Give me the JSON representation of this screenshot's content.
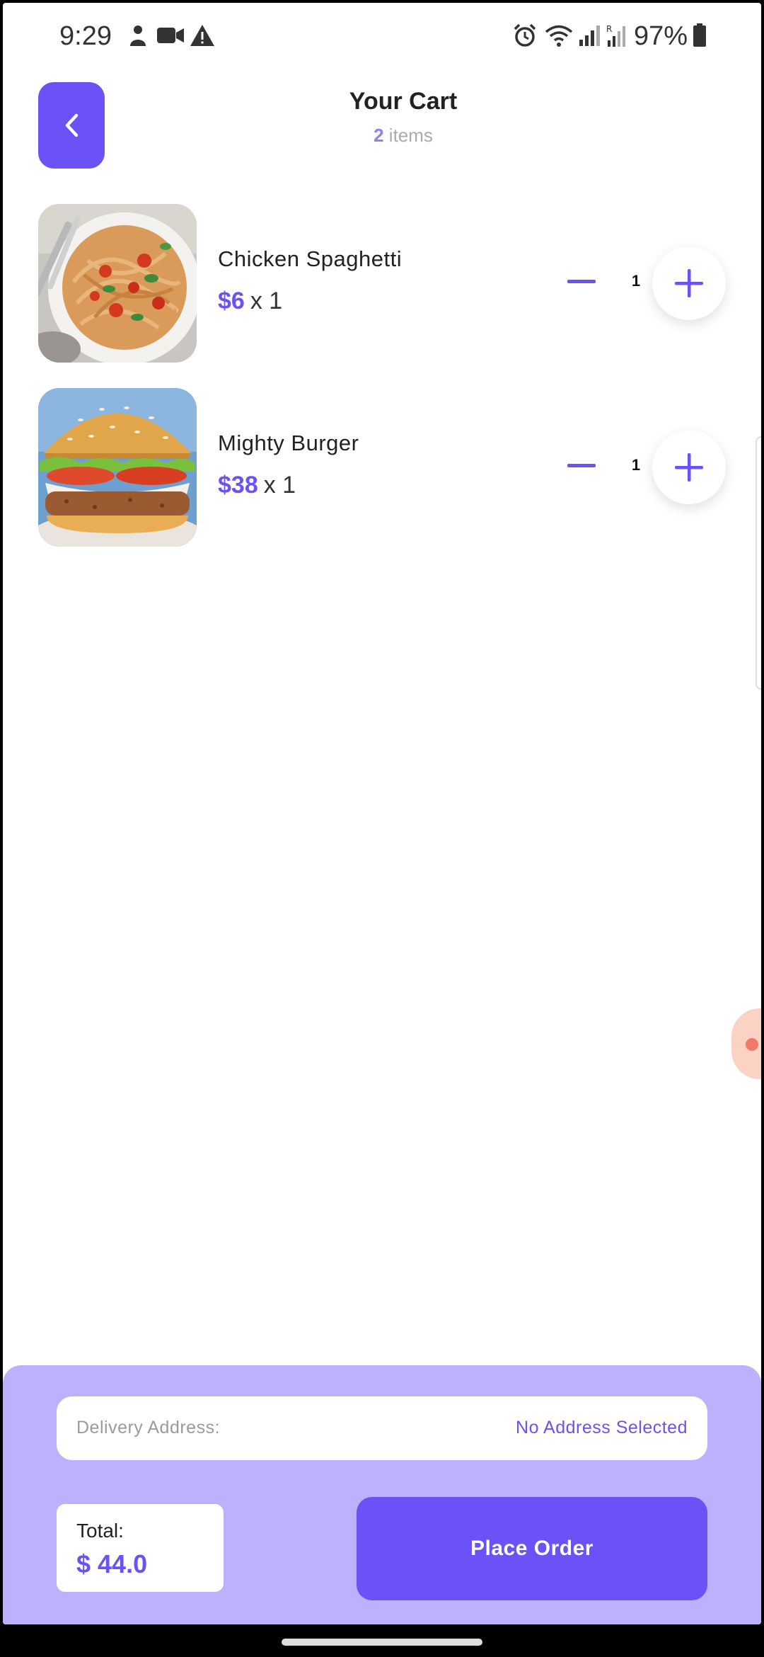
{
  "status_bar": {
    "time": "9:29",
    "battery_percent": "97%",
    "left_icons": [
      "person-notification-icon",
      "video-camera-icon",
      "warning-icon"
    ],
    "right_icons": [
      "alarm-icon",
      "wifi-icon",
      "signal-icon",
      "roaming-signal-icon",
      "battery-icon"
    ]
  },
  "header": {
    "title": "Your Cart",
    "item_count": "2",
    "items_suffix": " items"
  },
  "cart": {
    "items": [
      {
        "name": "Chicken Spaghetti",
        "price": "$6",
        "multiplier": "x 1",
        "quantity": "1",
        "image": "spaghetti-photo"
      },
      {
        "name": "Mighty Burger",
        "price": "$38",
        "multiplier": "x 1",
        "quantity": "1",
        "image": "burger-photo"
      }
    ]
  },
  "checkout": {
    "address_label": "Delivery Address:",
    "address_value": "No Address Selected",
    "total_label": "Total:",
    "total_value": "$ 44.0",
    "place_order_label": "Place Order"
  },
  "colors": {
    "accent": "#6a52f7",
    "panel": "#bdb0fd",
    "muted": "#a9a9b8"
  }
}
